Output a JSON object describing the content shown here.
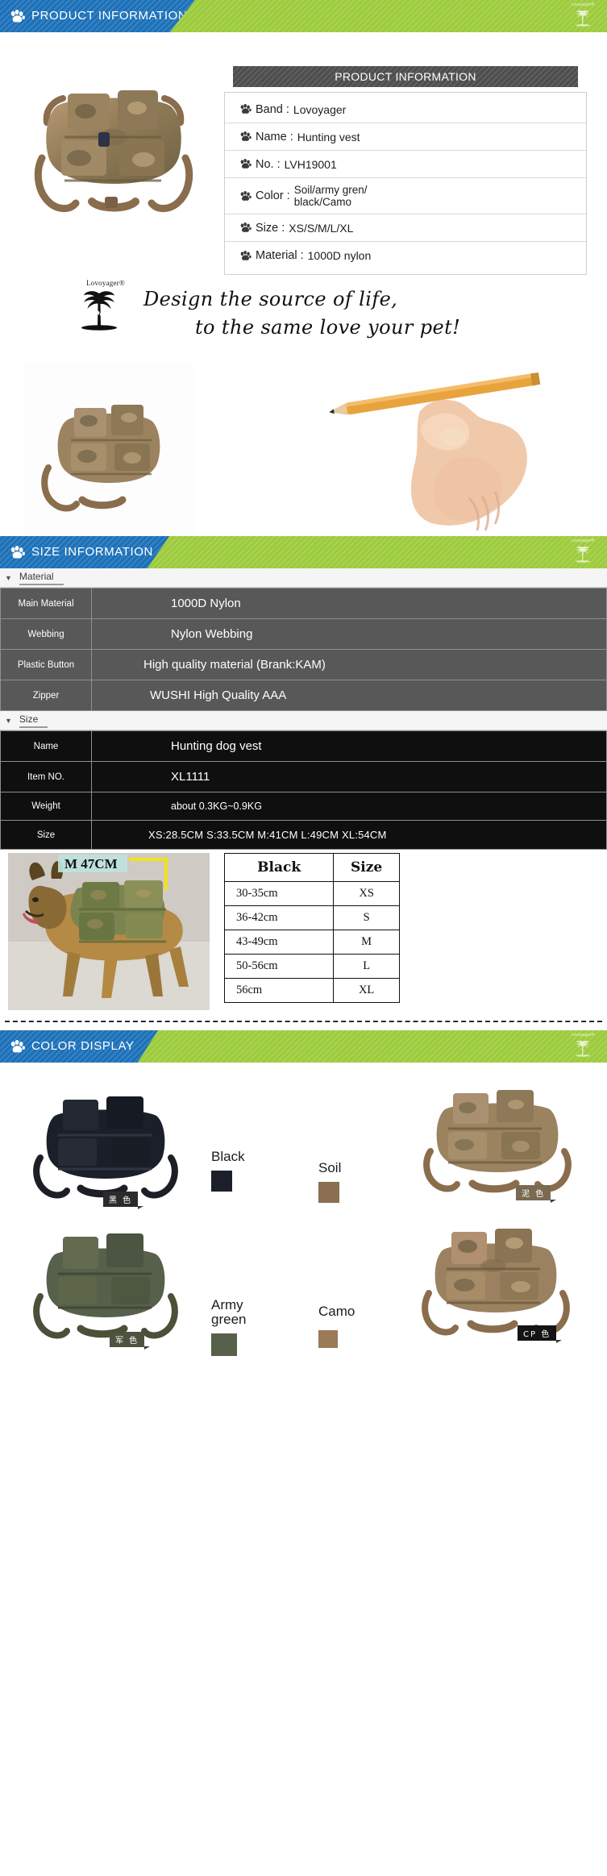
{
  "sections": {
    "product_information": {
      "title": "PRODUCT INFORMATION"
    },
    "size_information": {
      "title": "SIZE INFORMATION"
    },
    "color_display": {
      "title": "COLOR DISPLAY"
    }
  },
  "brand": {
    "name": "Lovoyager",
    "registered": "®"
  },
  "spec_card": {
    "heading": "PRODUCT INFORMATION",
    "rows": [
      {
        "label": "Band :",
        "value": "Lovoyager"
      },
      {
        "label": "Name :",
        "value": "Hunting vest"
      },
      {
        "label": "No. :",
        "value": "LVH19001"
      },
      {
        "label": "Color :",
        "value": "Soil/army gren/\nblack/Camo"
      },
      {
        "label": "Size :",
        "value": "XS/S/M/L/XL"
      },
      {
        "label": "Material :",
        "value": "1000D nylon"
      }
    ]
  },
  "slogan": {
    "line1": "Design the source of life,",
    "line2": "to the same love your pet!",
    "logo_text": "Lovoyager®"
  },
  "material_table": {
    "caption": "Material",
    "rows": [
      {
        "key": "Main Material",
        "value": "1000D Nylon"
      },
      {
        "key": "Webbing",
        "value": "Nylon  Webbing"
      },
      {
        "key": "Plastic Button",
        "value": "High quality material (Brank:KAM)"
      },
      {
        "key": "Zipper",
        "value": "WUSHI High Quality AAA"
      }
    ]
  },
  "size_table": {
    "caption": "Size",
    "rows": [
      {
        "key": "Name",
        "value": "Hunting dog vest"
      },
      {
        "key": "Item NO.",
        "value": "XL1111"
      },
      {
        "key": "Weight",
        "value": "about 0.3KG~0.9KG"
      },
      {
        "key": "Size",
        "value": "XS:28.5CM  S:33.5CM  M:41CM  L:49CM  XL:54CM"
      }
    ]
  },
  "measure_table": {
    "headers": [
      "Black",
      "Size"
    ],
    "rows": [
      {
        "measure": "30-35cm",
        "size": "XS"
      },
      {
        "measure": "36-42cm",
        "size": "S"
      },
      {
        "measure": "43-49cm",
        "size": "M"
      },
      {
        "measure": "50-56cm",
        "size": "L"
      },
      {
        "measure": "56cm",
        "size": "XL"
      }
    ]
  },
  "dog_photo": {
    "annotation": "M 47CM"
  },
  "colors": [
    {
      "name": "Black",
      "swatch": "#1b1f2a",
      "cn_tag": "黑 色",
      "tag_bg": "#2b2b2b"
    },
    {
      "name": "Soil",
      "swatch": "#8a7050",
      "cn_tag": "泥 色",
      "tag_bg": "#7a6a52"
    },
    {
      "name": "Army\ngreen",
      "swatch": "#57604a",
      "cn_tag": "军 色",
      "tag_bg": "#4e5340"
    },
    {
      "name": "Camo",
      "swatch": "#9a7a58",
      "cn_tag": "CP 色",
      "tag_bg": "#141414"
    }
  ],
  "theme": {
    "blue": "#1b70b8",
    "green": "#9ccb3b",
    "dark_table": "#585858",
    "black_table": "#0f0f0f"
  }
}
